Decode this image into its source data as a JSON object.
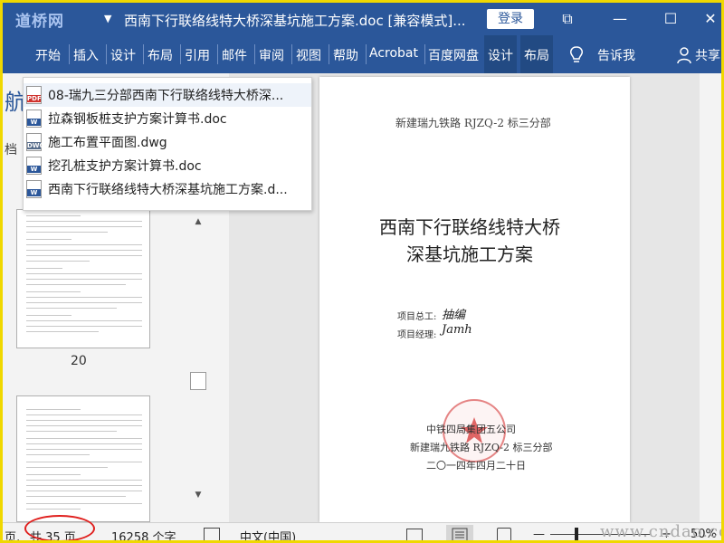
{
  "titlebar": {
    "logo": "道桥网",
    "title_dropdown": "▼",
    "document_title": "西南下行联络线特大桥深基坑施工方案.doc [兼容模式]...",
    "login_label": "登录",
    "restore_symbol": "⧉",
    "minimize_symbol": "—",
    "maximize_symbol": "☐",
    "close_symbol": "✕"
  },
  "ribbon": {
    "tabs": [
      "开始",
      "插入",
      "设计",
      "布局",
      "引用",
      "邮件",
      "审阅",
      "视图",
      "帮助",
      "Acrobat",
      "百度网盘",
      "设计",
      "布局"
    ],
    "tell_me": "告诉我",
    "share": "共享"
  },
  "recent_files": [
    {
      "name": "08-瑞九三分部西南下行联络线特大桥深...",
      "type": "pdf-icon"
    },
    {
      "name": "拉森钢板桩支护方案计算书.doc",
      "type": "word-icon"
    },
    {
      "name": "施工布置平面图.dwg",
      "type": "dwg-icon"
    },
    {
      "name": "挖孔桩支护方案计算书.doc",
      "type": "word-icon"
    },
    {
      "name": "西南下行联络线特大桥深基坑施工方案.d...",
      "type": "word-icon"
    }
  ],
  "navpane": {
    "side_text_top": "航",
    "side_text_mid": "档",
    "thumb_page_number": "20",
    "scroll_up": "▲",
    "scroll_down": "▼"
  },
  "page": {
    "header": "新建瑞九铁路 RJZQ-2 标三分部",
    "title_line1": "西南下行联络线特大桥",
    "title_line2": "深基坑施工方案",
    "chief_label": "项目总工:",
    "chief_sig": "抽编",
    "manager_label": "项目经理:",
    "manager_sig": "Jamh",
    "org": "中铁四局集团五公司",
    "project": "新建瑞九铁路 RJZQ-2 标三分部",
    "date": "二〇一四年四月二十日"
  },
  "statusbar": {
    "page_prefix": "页,",
    "page_count": "共 35 页",
    "word_count": "16258 个字",
    "language": "中文(中国)",
    "zoom": "50%",
    "zoom_minus": "—",
    "zoom_plus": "+"
  },
  "watermark": "www.cndao.com",
  "colors": {
    "ribbon_blue": "#2b579a",
    "frame_yellow": "#f0d800",
    "annotation_red": "#e0201e"
  }
}
